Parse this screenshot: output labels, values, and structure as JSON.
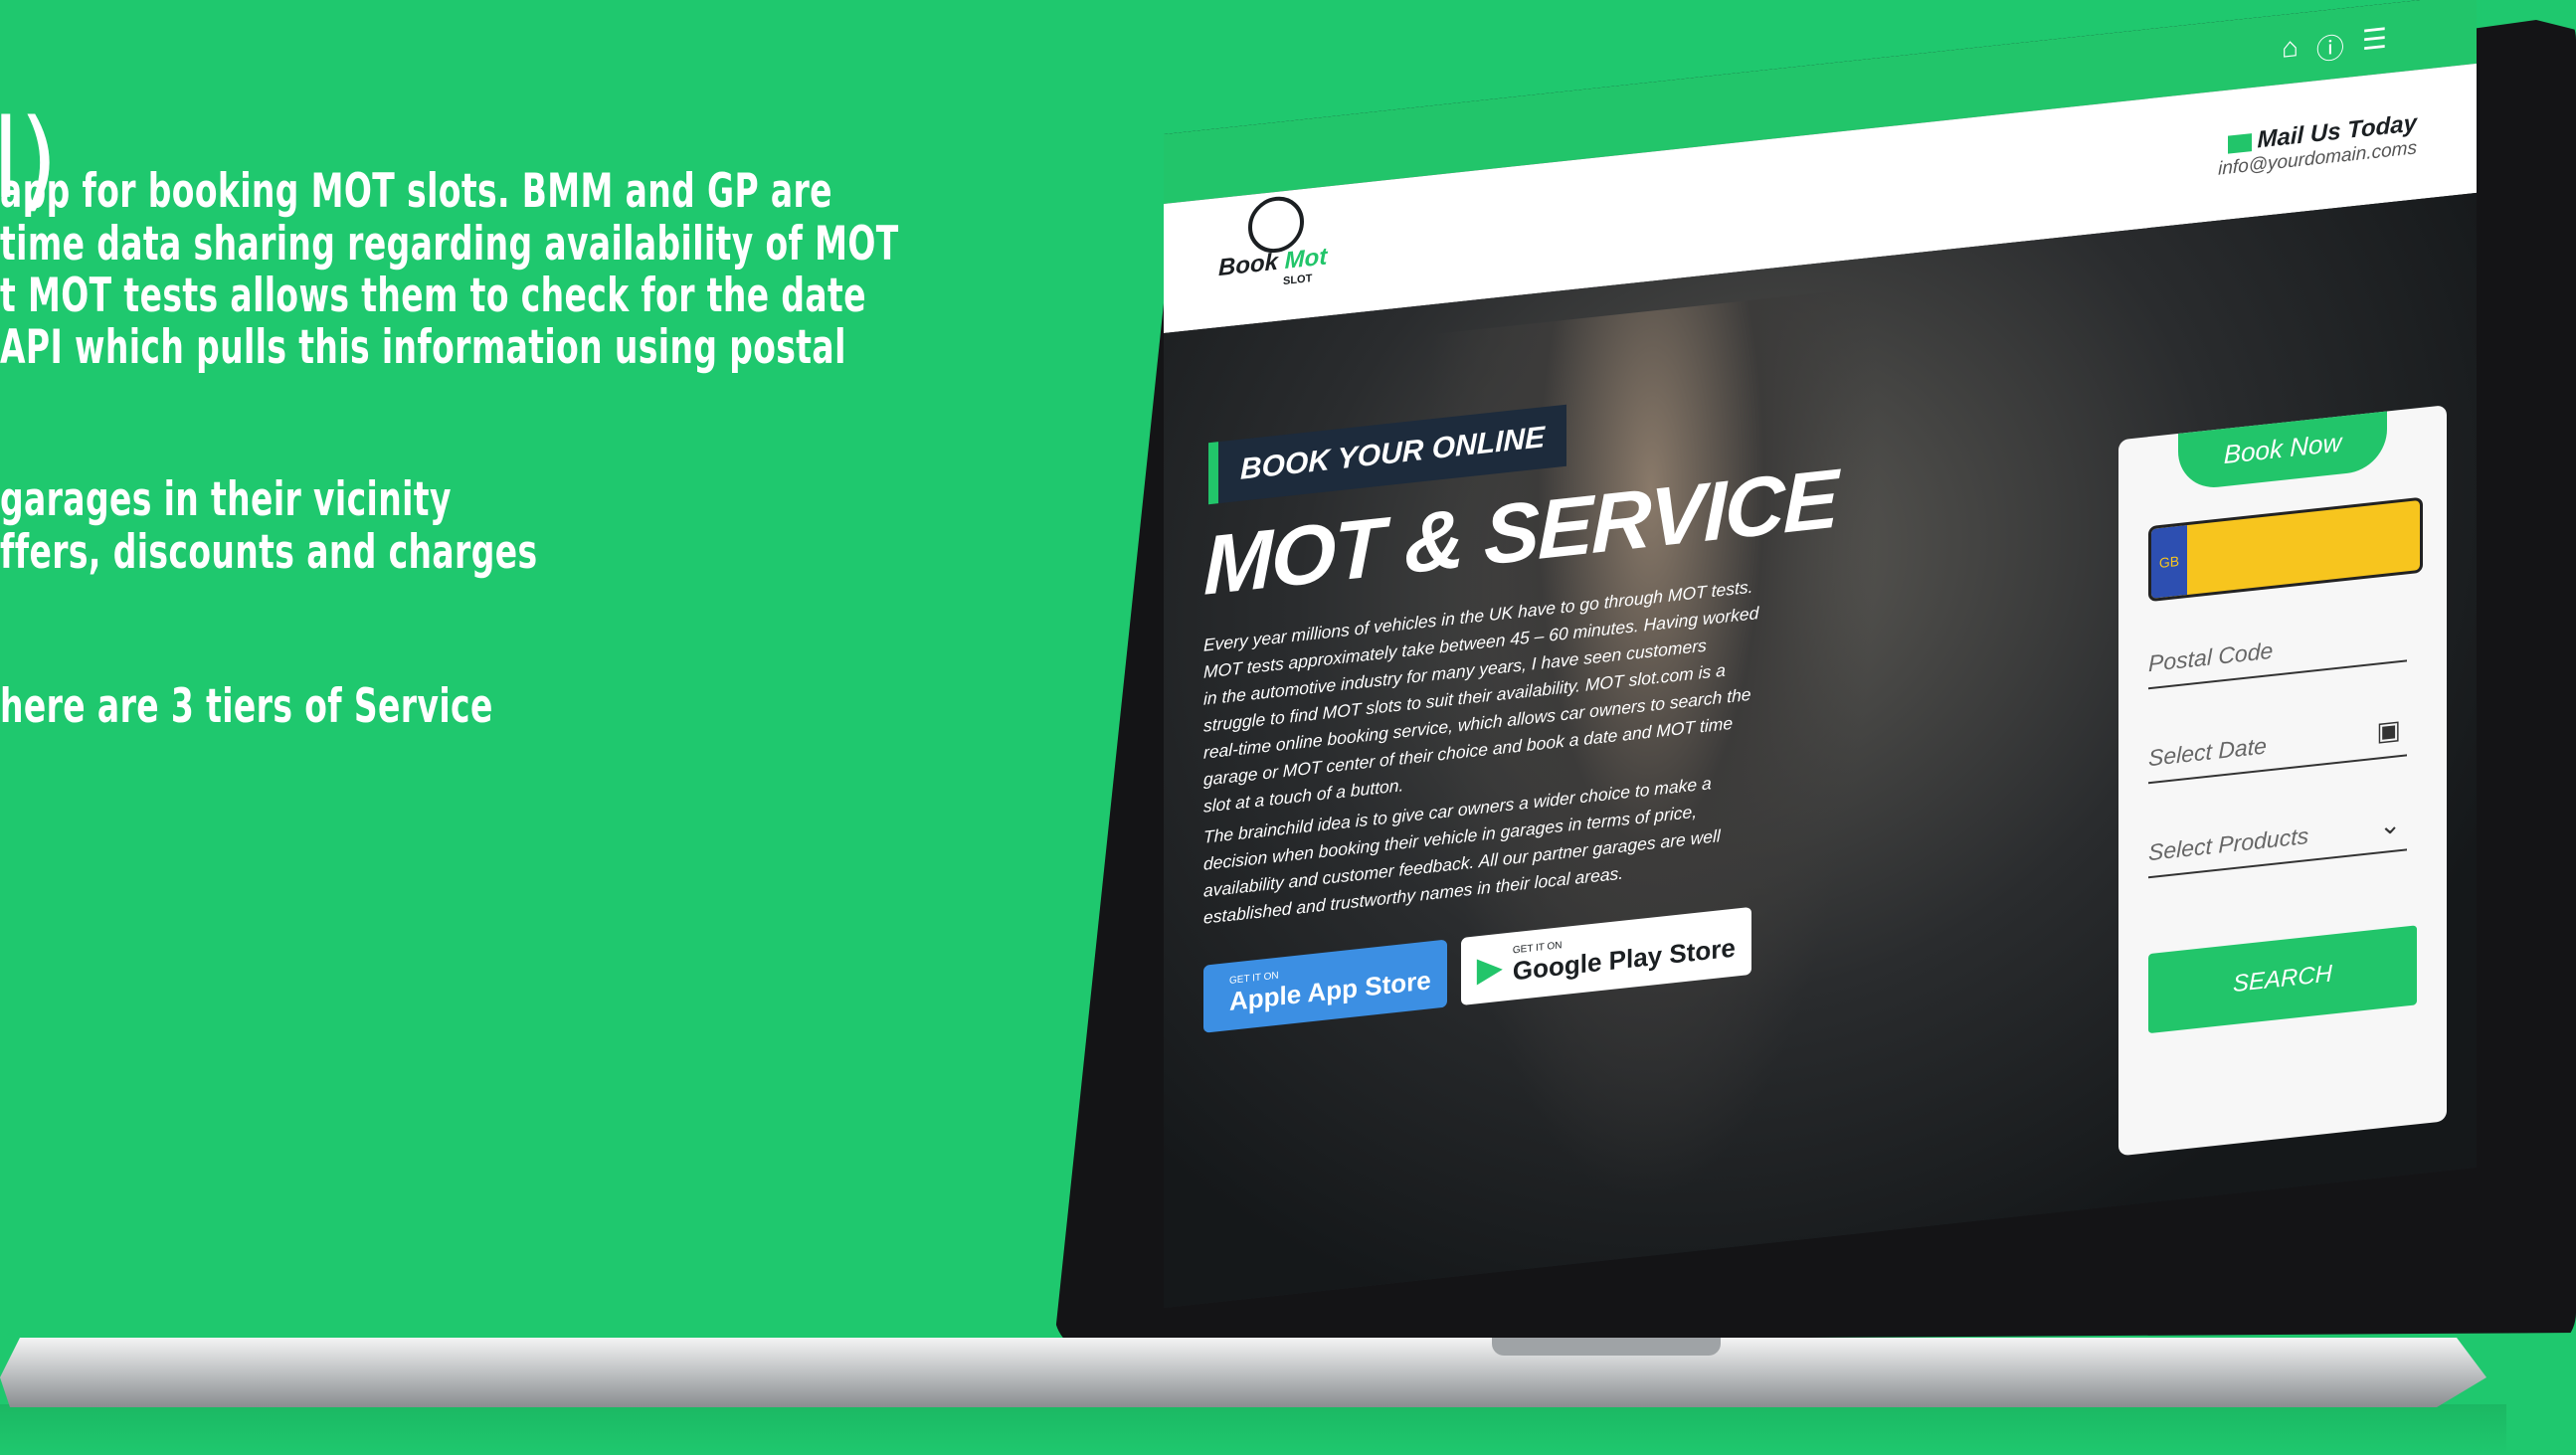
{
  "intro": {
    "paren": "l)",
    "lines": [
      "app for booking MOT slots. BMM and GP are",
      "time data sharing regarding availability of MOT",
      "t MOT tests allows them to check for the date",
      "API which pulls this information using postal",
      "garages in their vicinity",
      "ffers, discounts and charges",
      "here are 3 tiers of Service"
    ]
  },
  "site": {
    "top_icons": [
      "home-icon",
      "info-icon",
      "menu-icon"
    ],
    "logo": {
      "brand_dark": "Book",
      "brand_green": "Mot",
      "sub": "SLOT"
    },
    "mail": {
      "label": "Mail Us Today",
      "email": "info@yourdomain.coms"
    },
    "hero": {
      "tag": "BOOK YOUR ONLINE",
      "title": "MOT & SERVICE",
      "paragraph_1": "Every year millions of vehicles in the UK have to go through MOT tests. MOT tests approximately take between 45 – 60 minutes. Having worked in the automotive industry for many years, I have seen customers struggle to find MOT slots to suit their availability. MOT slot.com is a real-time online booking service, which allows car owners to search the garage or MOT center of their choice and book a date and MOT time slot at a touch of a button.",
      "paragraph_2": "The brainchild idea is to give car owners a wider choice to make a decision when booking their vehicle in garages in terms of price, availability and customer feedback. All our partner garages are well established and trustworthy names in their local areas.",
      "apple": {
        "small": "GET IT ON",
        "big": "Apple App Store"
      },
      "google": {
        "small": "GET IT ON",
        "big": "Google Play Store"
      }
    },
    "booking": {
      "tab": "Book Now",
      "plate_badge": "GB",
      "postal_placeholder": "Postal Code",
      "date_placeholder": "Select Date",
      "products_placeholder": "Select Products",
      "search_label": "SEARCH"
    }
  },
  "colors": {
    "brand_green": "#22c56a",
    "background": "#1fc86e",
    "plate_yellow": "#f7c51e"
  }
}
